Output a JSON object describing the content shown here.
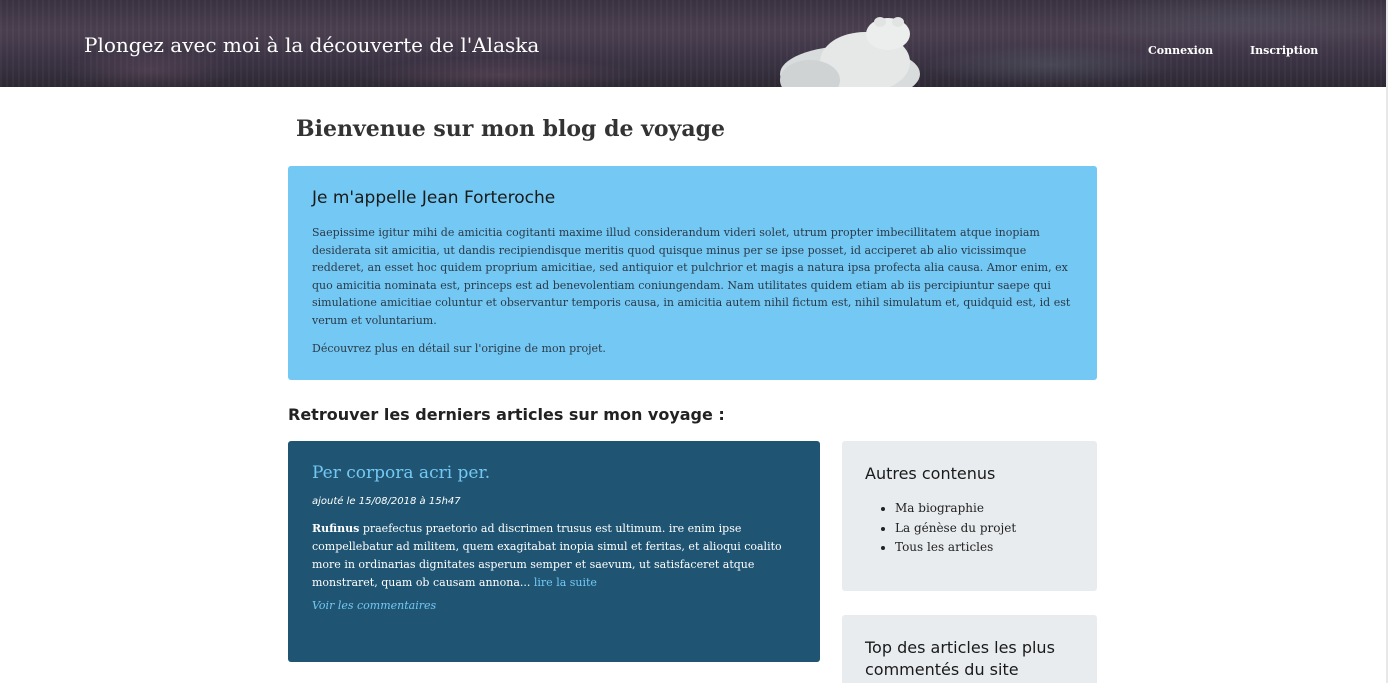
{
  "header": {
    "site_title": "Plongez avec moi à la découverte de l'Alaska",
    "nav": {
      "login": "Connexion",
      "signup": "Inscription"
    }
  },
  "main": {
    "page_title": "Bienvenue sur mon blog de voyage",
    "intro": {
      "heading": "Je m'appelle Jean Forteroche",
      "body": "Saepissime igitur mihi de amicitia cogitanti maxime illud considerandum videri solet, utrum propter imbecillitatem atque inopiam desiderata sit amicitia, ut dandis recipiendisque meritis quod quisque minus per se ipse posset, id acciperet ab alio vicissimque redderet, an esset hoc quidem proprium amicitiae, sed antiquior et pulchrior et magis a natura ipsa profecta alia causa. Amor enim, ex quo amicitia nominata est, princeps est ad benevolentiam coniungendam. Nam utilitates quidem etiam ab iis percipiuntur saepe qui simulatione amicitiae coluntur et observantur temporis causa, in amicitia autem nihil fictum est, nihil simulatum et, quidquid est, id est verum et voluntarium.",
      "more_link": "Découvrez plus en détail sur l'origine de mon projet."
    },
    "articles_title": "Retrouver les derniers articles sur mon voyage :",
    "article": {
      "title": "Per corpora acri per.",
      "date": "ajouté le 15/08/2018 à 15h47",
      "excerpt_bold": "Rufinus",
      "excerpt": " praefectus praetorio ad discrimen trusus est ultimum. ire enim ipse compellebatur ad militem, quem exagitabat inopia simul et feritas, et alioqui coalito more in ordinarias dignitates asperum semper et saevum, ut satisfaceret atque monstraret, quam ob causam annona... ",
      "read_more": "lire la suite",
      "comments_link": "Voir les commentaires"
    }
  },
  "sidebar": {
    "other": {
      "title": "Autres contenus",
      "items": [
        "Ma biographie",
        "La génèse du projet",
        "Tous les articles"
      ]
    },
    "top": {
      "title": "Top des articles les plus commentés du site"
    }
  },
  "colors": {
    "intro_bg": "#74c8f4",
    "article_bg": "#1f5573",
    "sidebar_bg": "#e8ecef",
    "link": "#74c8f4"
  }
}
